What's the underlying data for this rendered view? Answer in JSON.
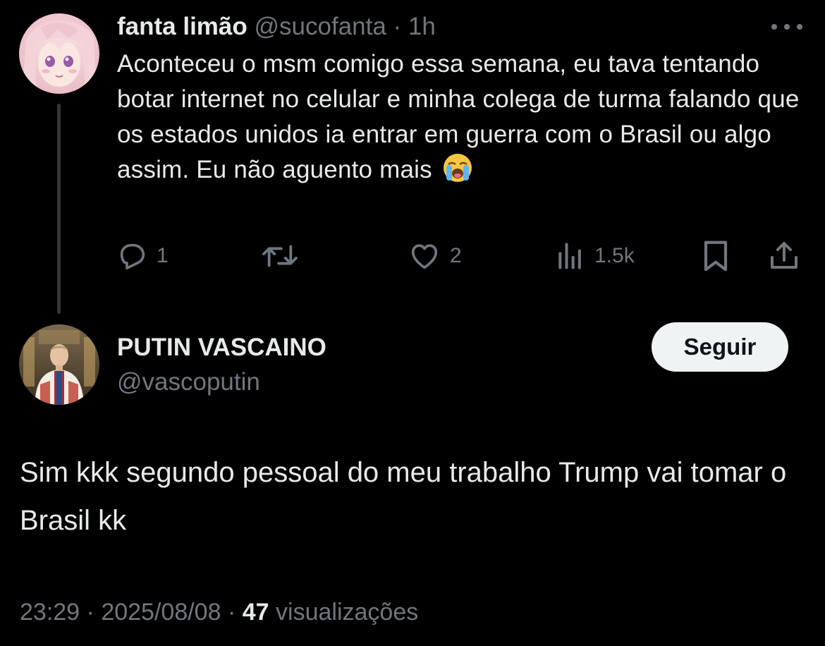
{
  "parent_tweet": {
    "author_name": "fanta limão",
    "author_handle": "@sucofanta",
    "separator": "·",
    "time_ago": "1h",
    "text": "Aconteceu o msm comigo essa semana, eu tava tentando botar internet no celular e minha colega de turma falando que os estados unidos ia entrar em guerra com o Brasil ou algo assim. Eu não aguento mais",
    "emoji": "loudly-crying-face",
    "actions": {
      "reply_count": "1",
      "retweet_count": "",
      "like_count": "2",
      "views_count": "1.5k"
    },
    "icons": [
      "more-icon",
      "reply-icon",
      "retweet-icon",
      "like-icon",
      "views-icon",
      "bookmark-icon",
      "share-icon"
    ]
  },
  "main_tweet": {
    "author_name": "PUTIN VASCAINO",
    "author_handle": "@vascoputin",
    "follow_label": "Seguir",
    "text": "Sim kkk segundo pessoal do meu trabalho Trump vai tomar o Brasil kk",
    "time": "23:29",
    "separator": "·",
    "date": "2025/08/08",
    "views_count": "47",
    "views_label": "visualizações"
  },
  "colors": {
    "background": "#000000",
    "primary_text": "#e7e9ea",
    "secondary_text": "#71767b",
    "thread_line": "#333639",
    "follow_button_bg": "#eff3f4",
    "follow_button_text": "#0f1419"
  }
}
